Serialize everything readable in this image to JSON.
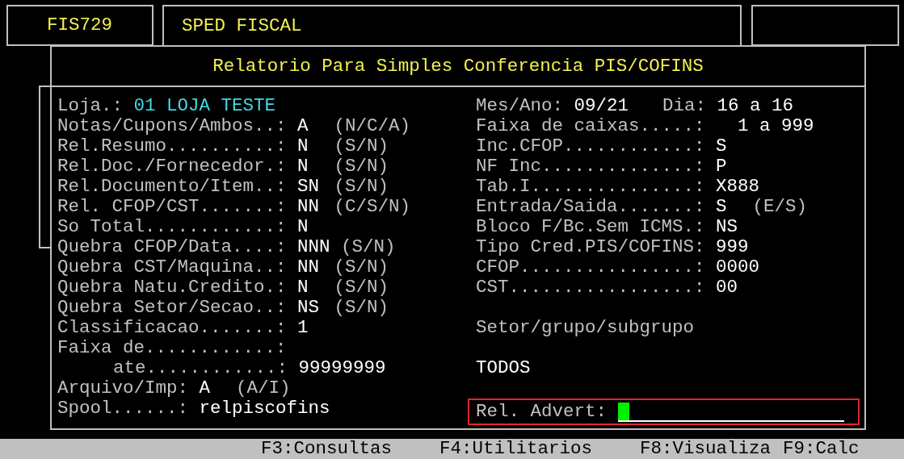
{
  "header": {
    "program_code": "FIS729",
    "title": "SPED FISCAL"
  },
  "dialog": {
    "title": "Relatorio Para Simples Conferencia PIS/COFINS",
    "store": {
      "label": "Loja.:",
      "value": "01 LOJA TESTE"
    },
    "left_fields": [
      {
        "kind": "field",
        "label": "Notas/Cupons/Ambos..:",
        "value": "A",
        "hint": "(N/C/A)"
      },
      {
        "kind": "field",
        "label": "Rel.Resumo..........:",
        "value": "N",
        "hint": "(S/N)"
      },
      {
        "kind": "field",
        "label": "Rel.Doc./Fornecedor.:",
        "value": "N",
        "hint": "(S/N)"
      },
      {
        "kind": "field",
        "label": "Rel.Documento/Item..:",
        "value": "SN",
        "hint": "(S/N)"
      },
      {
        "kind": "field",
        "label": "Rel. CFOP/CST.......:",
        "value": "NN",
        "hint": "(C/S/N)"
      },
      {
        "kind": "field",
        "label": "So Total............:",
        "value": "N"
      },
      {
        "kind": "field",
        "label": "Quebra CFOP/Data....:",
        "value": "NNN",
        "hint": "(S/N)"
      },
      {
        "kind": "field",
        "label": "Quebra CST/Maquina..:",
        "value": "NN",
        "hint": "(S/N)"
      },
      {
        "kind": "field",
        "label": "Quebra Natu.Credito.:",
        "value": "N",
        "hint": "(S/N)"
      },
      {
        "kind": "field",
        "label": "Quebra Setor/Secao..:",
        "value": "NS",
        "hint": "(S/N)"
      },
      {
        "kind": "field",
        "label": "Classificacao.......:",
        "value": "1"
      },
      {
        "kind": "field",
        "label": "Faixa de............:"
      },
      {
        "kind": "sub",
        "label": "ate............:",
        "value": "99999999"
      },
      {
        "kind": "field",
        "label": "Arquivo/Imp:",
        "value": "A",
        "hint": "(A/I)"
      },
      {
        "kind": "field",
        "label": "Spool......:",
        "value": "relpiscofins"
      }
    ],
    "right_fields": [
      {
        "kind": "period",
        "label": "Mes/Ano:",
        "value": "09/21",
        "day_label": "Dia:",
        "day_value": "16 a 16"
      },
      {
        "kind": "field",
        "label": "Faixa de caixas.....:",
        "value": "  1 a 999"
      },
      {
        "kind": "field",
        "label": "Inc.CFOP............:",
        "value": "S"
      },
      {
        "kind": "field",
        "label": "NF Inc..............:",
        "value": "P"
      },
      {
        "kind": "field",
        "label": "Tab.I...............:",
        "value": "X888"
      },
      {
        "kind": "field",
        "label": "Entrada/Saida.......:",
        "value": "S",
        "hint": "(E/S)"
      },
      {
        "kind": "field",
        "label": "Bloco F/Bc.Sem ICMS.:",
        "value": "NS"
      },
      {
        "kind": "field",
        "label": "Tipo Cred.PIS/COFINS:",
        "value": "999"
      },
      {
        "kind": "field",
        "label": "CFOP................:",
        "value": "0000"
      },
      {
        "kind": "field",
        "label": "CST.................:",
        "value": "00"
      },
      {
        "kind": "text",
        "text": "Setor/grupo/subgrupo"
      },
      {
        "kind": "value_text",
        "text": "TODOS"
      },
      {
        "kind": "prompt",
        "label": "Rel. Advert:"
      }
    ]
  },
  "function_keys": [
    "F3:Consultas",
    "F4:Utilitarios",
    "F8:Visualiza",
    "F9:Calc"
  ]
}
